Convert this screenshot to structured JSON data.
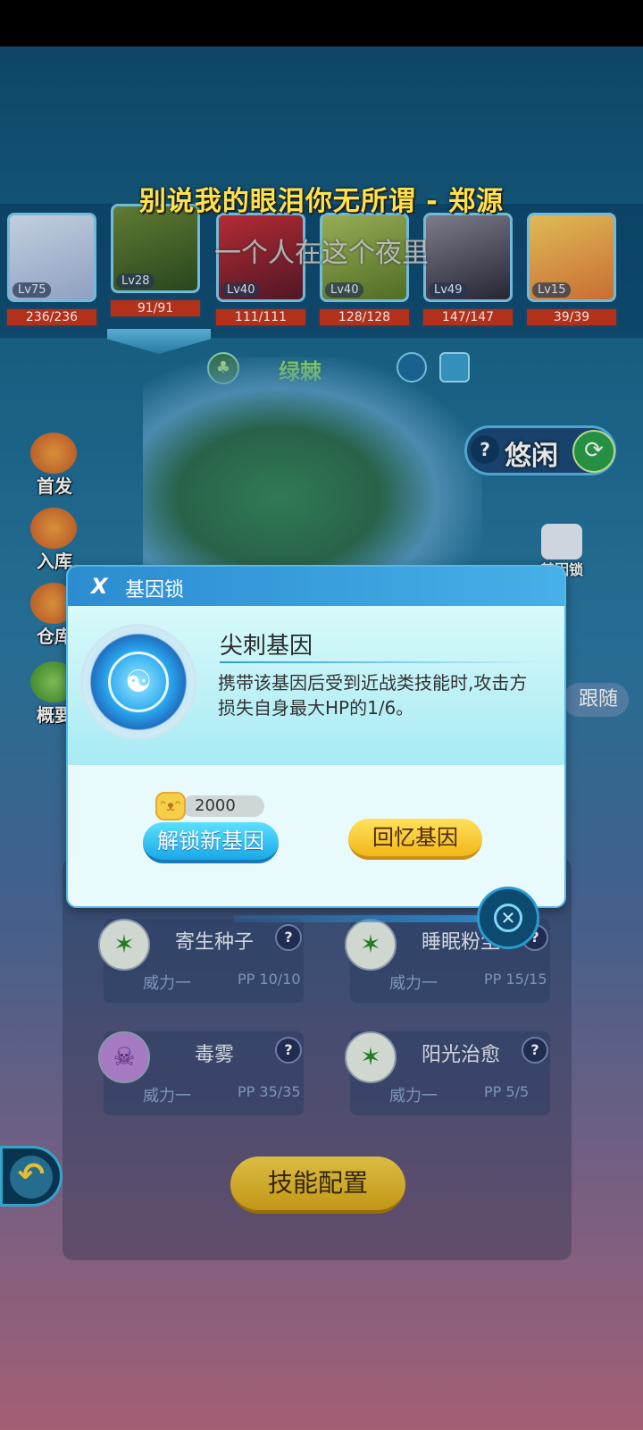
{
  "lyrics": {
    "line1": "别说我的眼泪你无所谓 - 郑源",
    "line2": "一个人在这个夜里"
  },
  "team": [
    {
      "level": "Lv75",
      "hp": "236/236"
    },
    {
      "level": "Lv28",
      "hp": "91/91",
      "selected": true
    },
    {
      "level": "Lv40",
      "hp": "111/111"
    },
    {
      "level": "Lv40",
      "hp": "128/128"
    },
    {
      "level": "Lv49",
      "hp": "147/147"
    },
    {
      "level": "Lv15",
      "hp": "39/39"
    }
  ],
  "pet": {
    "name": "绿棘",
    "element_icon": "leaf-icon",
    "nature": "悠闲",
    "nature_help": "?",
    "refresh_icon": "refresh-icon"
  },
  "side_menu": [
    {
      "label": "首发",
      "icon": "first-icon"
    },
    {
      "label": "入库",
      "icon": "storage-icon"
    },
    {
      "label": "仓库",
      "icon": "warehouse-icon"
    },
    {
      "label": "概要",
      "icon": "summary-icon"
    }
  ],
  "right_menu": {
    "gene_lock_label": "基因锁",
    "follow_label": "跟随"
  },
  "skills": [
    {
      "name": "寄生种子",
      "power": "威力一",
      "pp": "PP 10/10",
      "icon": "grass-icon",
      "help": "?"
    },
    {
      "name": "睡眠粉尘",
      "power": "威力一",
      "pp": "PP 15/15",
      "icon": "grass-icon",
      "help": "?"
    },
    {
      "name": "毒雾",
      "power": "威力一",
      "pp": "PP 35/35",
      "icon": "poison-icon",
      "help": "?"
    },
    {
      "name": "阳光治愈",
      "power": "威力一",
      "pp": "PP 5/5",
      "icon": "grass-icon",
      "help": "?"
    }
  ],
  "skill_config_label": "技能配置",
  "dialog": {
    "title": "基因锁",
    "gene_name": "尖刺基因",
    "gene_desc": "携带该基因后受到近战类技能时,攻击方损失自身最大HP的1/6。",
    "cost": "2000",
    "unlock_label": "解锁新基因",
    "recall_label": "回忆基因",
    "close_symbol": "✕"
  },
  "colors": {
    "accent_blue": "#2c8cd0",
    "hp_red": "#c8371e",
    "lyric_yellow": "#ffe24a",
    "button_yellow": "#f4d34a"
  }
}
